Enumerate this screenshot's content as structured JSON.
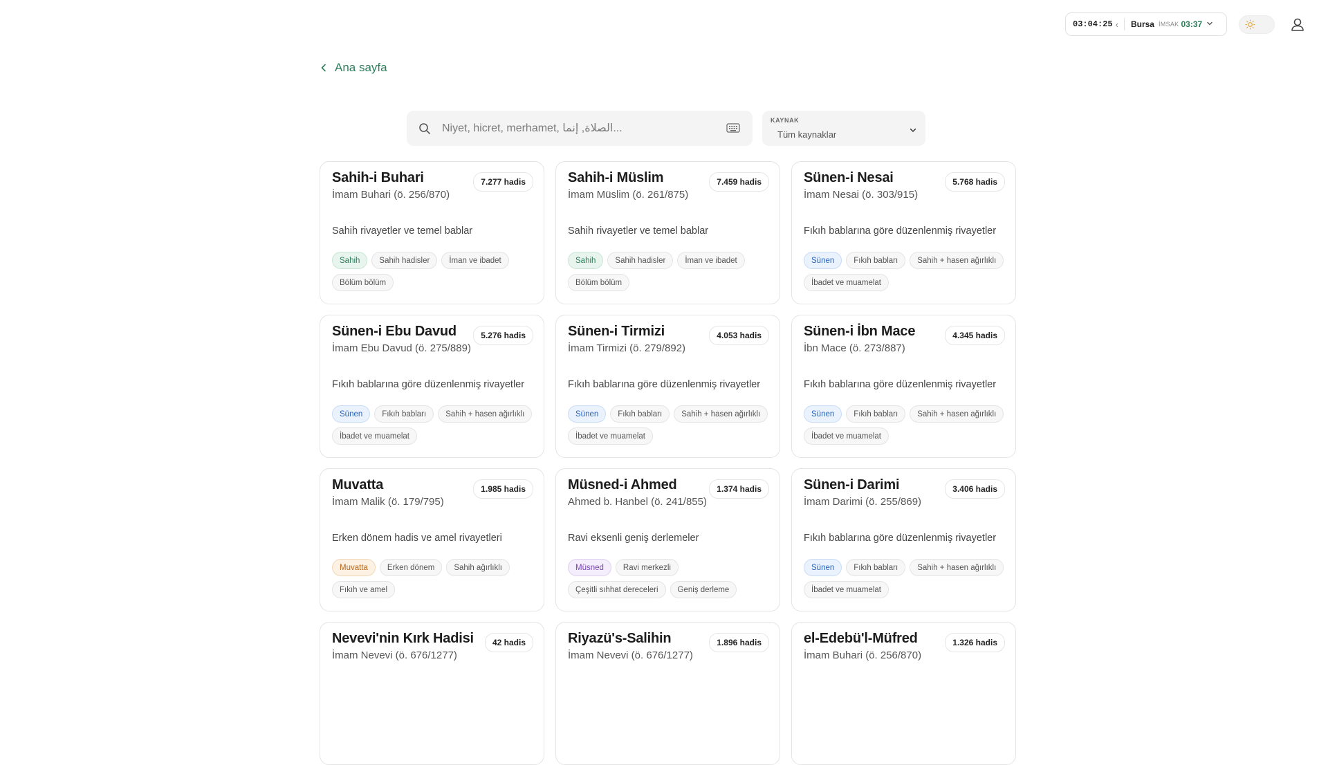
{
  "topbar": {
    "time": "03:04:25",
    "city": "Bursa",
    "prayer_label": "İMSAK",
    "prayer_time": "03:37",
    "accent": "#2e7d5b"
  },
  "nav": {
    "back_label": "Ana sayfa"
  },
  "search": {
    "placeholder": "Niyet, hicret, merhamet, الصلاة, إنما...",
    "value": ""
  },
  "source_filter": {
    "label": "KAYNAK",
    "selected": "Tüm kaynaklar"
  },
  "tag_colors": {
    "green": "#2e7d5b",
    "blue": "#2b63b8",
    "orange": "#b9671a",
    "purple": "#7b44b4",
    "neutral": "#555555"
  },
  "books": [
    {
      "title": "Sahih-i Buhari",
      "author": "İmam Buhari (ö. 256/870)",
      "count": "7.277 hadis",
      "desc": "Sahih rivayetler ve temel bablar",
      "tags": [
        {
          "label": "Sahih",
          "color": "green"
        },
        {
          "label": "Sahih hadisler",
          "color": "neutral"
        },
        {
          "label": "İman ve ibadet",
          "color": "neutral"
        },
        {
          "label": "Bölüm bölüm",
          "color": "neutral"
        }
      ]
    },
    {
      "title": "Sahih-i Müslim",
      "author": "İmam Müslim (ö. 261/875)",
      "count": "7.459 hadis",
      "desc": "Sahih rivayetler ve temel bablar",
      "tags": [
        {
          "label": "Sahih",
          "color": "green"
        },
        {
          "label": "Sahih hadisler",
          "color": "neutral"
        },
        {
          "label": "İman ve ibadet",
          "color": "neutral"
        },
        {
          "label": "Bölüm bölüm",
          "color": "neutral"
        }
      ]
    },
    {
      "title": "Sünen-i Nesai",
      "author": "İmam Nesai (ö. 303/915)",
      "count": "5.768 hadis",
      "desc": "Fıkıh bablarına göre düzenlenmiş rivayetler",
      "tags": [
        {
          "label": "Sünen",
          "color": "blue"
        },
        {
          "label": "Fıkıh babları",
          "color": "neutral"
        },
        {
          "label": "Sahih + hasen ağırlıklı",
          "color": "neutral"
        },
        {
          "label": "İbadet ve muamelat",
          "color": "neutral"
        }
      ]
    },
    {
      "title": "Sünen-i Ebu Davud",
      "author": "İmam Ebu Davud (ö. 275/889)",
      "count": "5.276 hadis",
      "desc": "Fıkıh bablarına göre düzenlenmiş rivayetler",
      "tags": [
        {
          "label": "Sünen",
          "color": "blue"
        },
        {
          "label": "Fıkıh babları",
          "color": "neutral"
        },
        {
          "label": "Sahih + hasen ağırlıklı",
          "color": "neutral"
        },
        {
          "label": "İbadet ve muamelat",
          "color": "neutral"
        }
      ]
    },
    {
      "title": "Sünen-i Tirmizi",
      "author": "İmam Tirmizi (ö. 279/892)",
      "count": "4.053 hadis",
      "desc": "Fıkıh bablarına göre düzenlenmiş rivayetler",
      "tags": [
        {
          "label": "Sünen",
          "color": "blue"
        },
        {
          "label": "Fıkıh babları",
          "color": "neutral"
        },
        {
          "label": "Sahih + hasen ağırlıklı",
          "color": "neutral"
        },
        {
          "label": "İbadet ve muamelat",
          "color": "neutral"
        }
      ]
    },
    {
      "title": "Sünen-i İbn Mace",
      "author": "İbn Mace (ö. 273/887)",
      "count": "4.345 hadis",
      "desc": "Fıkıh bablarına göre düzenlenmiş rivayetler",
      "tags": [
        {
          "label": "Sünen",
          "color": "blue"
        },
        {
          "label": "Fıkıh babları",
          "color": "neutral"
        },
        {
          "label": "Sahih + hasen ağırlıklı",
          "color": "neutral"
        },
        {
          "label": "İbadet ve muamelat",
          "color": "neutral"
        }
      ]
    },
    {
      "title": "Muvatta",
      "author": "İmam Malik (ö. 179/795)",
      "count": "1.985 hadis",
      "desc": "Erken dönem hadis ve amel rivayetleri",
      "tags": [
        {
          "label": "Muvatta",
          "color": "orange"
        },
        {
          "label": "Erken dönem",
          "color": "neutral"
        },
        {
          "label": "Sahih ağırlıklı",
          "color": "neutral"
        },
        {
          "label": "Fıkıh ve amel",
          "color": "neutral"
        }
      ]
    },
    {
      "title": "Müsned-i Ahmed",
      "author": "Ahmed b. Hanbel (ö. 241/855)",
      "count": "1.374 hadis",
      "desc": "Ravi eksenli geniş derlemeler",
      "tags": [
        {
          "label": "Müsned",
          "color": "purple"
        },
        {
          "label": "Ravi merkezli",
          "color": "neutral"
        },
        {
          "label": "Çeşitli sıhhat dereceleri",
          "color": "neutral"
        },
        {
          "label": "Geniş derleme",
          "color": "neutral"
        }
      ]
    },
    {
      "title": "Sünen-i Darimi",
      "author": "İmam Darimi (ö. 255/869)",
      "count": "3.406 hadis",
      "desc": "Fıkıh bablarına göre düzenlenmiş rivayetler",
      "tags": [
        {
          "label": "Sünen",
          "color": "blue"
        },
        {
          "label": "Fıkıh babları",
          "color": "neutral"
        },
        {
          "label": "Sahih + hasen ağırlıklı",
          "color": "neutral"
        },
        {
          "label": "İbadet ve muamelat",
          "color": "neutral"
        }
      ]
    },
    {
      "title": "Nevevi'nin Kırk Hadisi",
      "author": "İmam Nevevi (ö. 676/1277)",
      "count": "42 hadis",
      "desc": "",
      "tags": []
    },
    {
      "title": "Riyazü's-Salihin",
      "author": "İmam Nevevi (ö. 676/1277)",
      "count": "1.896 hadis",
      "desc": "",
      "tags": []
    },
    {
      "title": "el-Edebü'l-Müfred",
      "author": "İmam Buhari (ö. 256/870)",
      "count": "1.326 hadis",
      "desc": "",
      "tags": []
    }
  ]
}
